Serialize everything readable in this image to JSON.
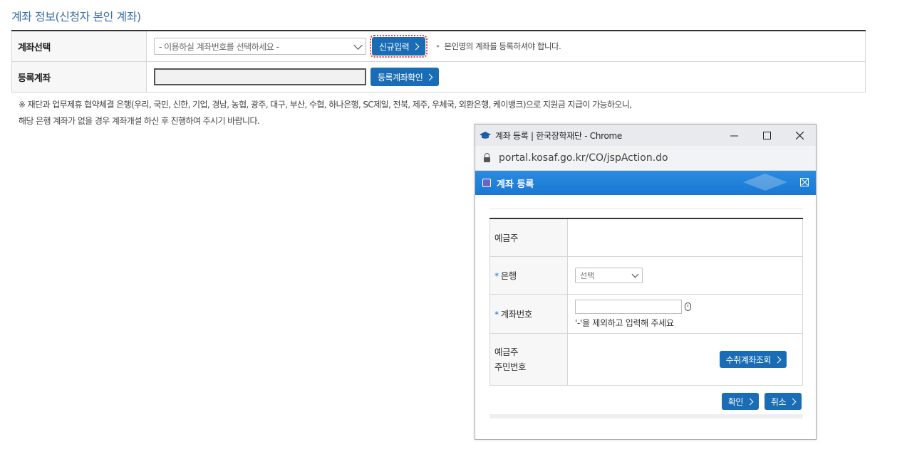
{
  "section": {
    "title": "계좌 정보(신청자 본인 계좌)"
  },
  "form": {
    "account_select": {
      "label": "계좌선택",
      "placeholder": "- 이용하실 계좌번호를 선택하세요 -",
      "new_button": "신규입력",
      "note": "본인명의 계좌를 등록하셔야 합니다."
    },
    "registered_account": {
      "label": "등록계좌",
      "value": "",
      "confirm_button": "등록계좌확인"
    }
  },
  "notice": {
    "line1": "※ 재단과 업무제휴 협약체결 은행(우리, 국민, 신한, 기업, 경남, 농협, 광주, 대구, 부산, 수협, 하나은행, SC제일, 전북, 제주, 우체국, 외환은행, 케이뱅크)으로 지원금 지급이 가능하오니,",
    "line2": "해당 은행 계좌가 없을 경우 계좌개설 하신 후 진행하여 주시기 바랍니다."
  },
  "popup": {
    "window_title": "계좌 등록 | 한국장학재단 - Chrome",
    "url": "portal.kosaf.go.kr/CO/jspAction.do",
    "header_title": "계좌 등록",
    "rows": {
      "depositor_label": "예금주",
      "depositor_value": "",
      "bank_label": "은행",
      "bank_selected": "선택",
      "account_label": "계좌번호",
      "account_value": "",
      "account_hint": "'-'을 제외하고 입력해 주세요",
      "rrn_label_1": "예금주",
      "rrn_label_2": "주민번호",
      "lookup_button": "수취계좌조회"
    },
    "confirm_button": "확인",
    "cancel_button": "취소",
    "required_mark": "*"
  },
  "colors": {
    "primary_button": "#1a6db5",
    "popup_header": "#1a78d2",
    "section_title": "#3a6fa8"
  }
}
